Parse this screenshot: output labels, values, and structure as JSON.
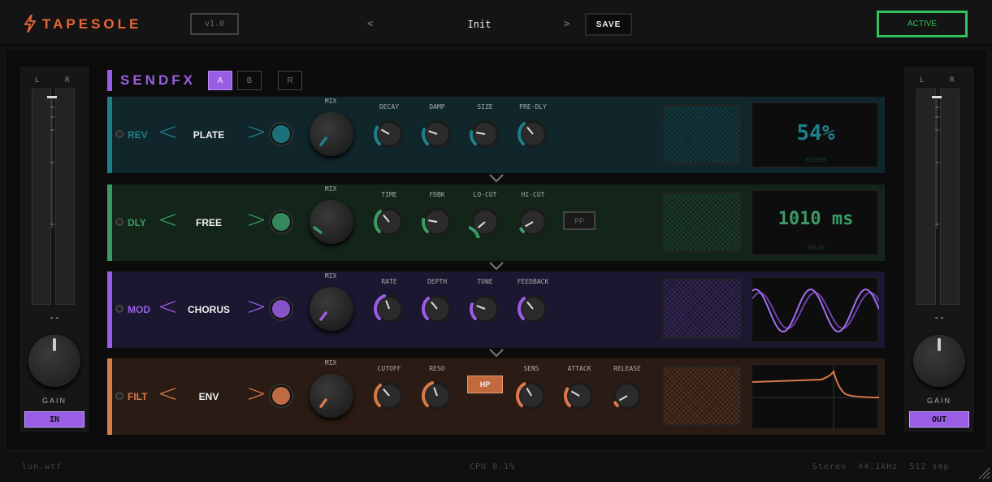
{
  "header": {
    "brand": "TAPESOLE",
    "version": "v1.0",
    "prev_symbol": "<",
    "next_symbol": ">",
    "preset": "Init",
    "save_label": "SAVE",
    "status_label": "ACTIVE"
  },
  "meters": {
    "left": {
      "l": "L",
      "r": "R",
      "peak": "--",
      "gain_label": "GAIN",
      "button": "IN"
    },
    "right": {
      "l": "L",
      "r": "R",
      "peak": "--",
      "gain_label": "GAIN",
      "button": "OUT"
    }
  },
  "sendfx": {
    "title": "SENDFX",
    "slots": [
      "A",
      "B",
      "R"
    ],
    "selected_slot": "A"
  },
  "rows": [
    {
      "label": "REV",
      "type": "PLATE",
      "mix_label": "MIX",
      "color": "#1e7f8a",
      "knobs": [
        "DECAY",
        "DAMP",
        "SIZE",
        "PRE-DLY"
      ],
      "display_value": "54%",
      "display_caption": "REVERB"
    },
    {
      "label": "DLY",
      "type": "FREE",
      "mix_label": "MIX",
      "color": "#3c9a66",
      "knobs": [
        "TIME",
        "FDBK",
        "LO-CUT",
        "HI-CUT"
      ],
      "pill": "PP",
      "display_value": "1010 ms",
      "display_caption": "DELAY"
    },
    {
      "label": "MOD",
      "type": "CHORUS",
      "mix_label": "MIX",
      "color": "#9b5de5",
      "knobs": [
        "RATE",
        "DEPTH",
        "TONE",
        "FEEDBACK"
      ]
    },
    {
      "label": "FILT",
      "type": "ENV",
      "mix_label": "MIX",
      "color": "#d9794a",
      "knobs": [
        "CUTOFF",
        "RESO",
        "SENS",
        "ATTACK",
        "RELEASE"
      ],
      "pill": "HP"
    }
  ],
  "footer": {
    "left": "lun.wtf",
    "center": "CPU 0.1%",
    "right": "Stereo  44.1kHz  512 smp"
  }
}
